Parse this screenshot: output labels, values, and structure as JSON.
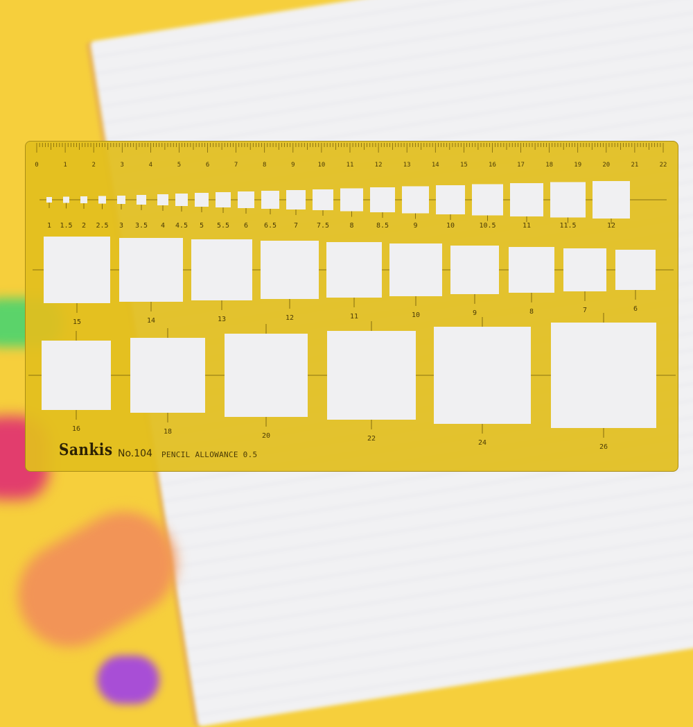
{
  "scene": {
    "description_objects": [
      "notebook",
      "green-marker",
      "red-marker",
      "orange-marker",
      "purple-marker",
      "square-template"
    ]
  },
  "template": {
    "brand": "Sankis",
    "model": "No.104",
    "allowance_text": "PENCIL ALLOWANCE 0.5",
    "color": "#e2be1e",
    "ruler_numbers": [
      "0",
      "1",
      "2",
      "3",
      "4",
      "5",
      "6",
      "7",
      "8",
      "9",
      "10",
      "11",
      "12",
      "13",
      "14",
      "15",
      "16",
      "17",
      "18",
      "19",
      "20",
      "21",
      "22"
    ],
    "row1_labels": [
      "1",
      "1.5",
      "2",
      "2.5",
      "3",
      "3.5",
      "4",
      "4.5",
      "5",
      "5.5",
      "6",
      "6.5",
      "7",
      "7.5",
      "8",
      "8.5",
      "9",
      "10",
      "10.5",
      "11",
      "11.5",
      "12"
    ],
    "row2_labels": [
      "15",
      "14",
      "13",
      "12",
      "11",
      "10",
      "9",
      "8",
      "7",
      "6"
    ],
    "row3_labels": [
      "16",
      "18",
      "20",
      "22",
      "24",
      "26"
    ]
  }
}
